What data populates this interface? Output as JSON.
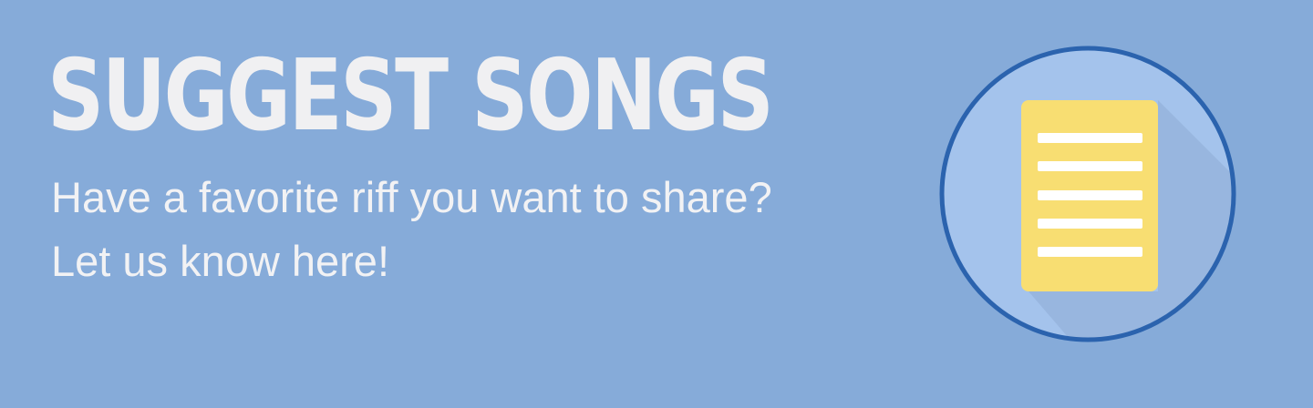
{
  "banner": {
    "title": "SUGGEST SONGS",
    "subtitle_line1": "Have a favorite riff you want to share?",
    "subtitle_line2": "Let us know here!",
    "icon": "document-icon"
  },
  "colors": {
    "background": "#86abd9",
    "circle_fill": "#a4c3ec",
    "circle_border": "#2b63ae",
    "document": "#f8de72",
    "text": "#f0f0f2"
  }
}
